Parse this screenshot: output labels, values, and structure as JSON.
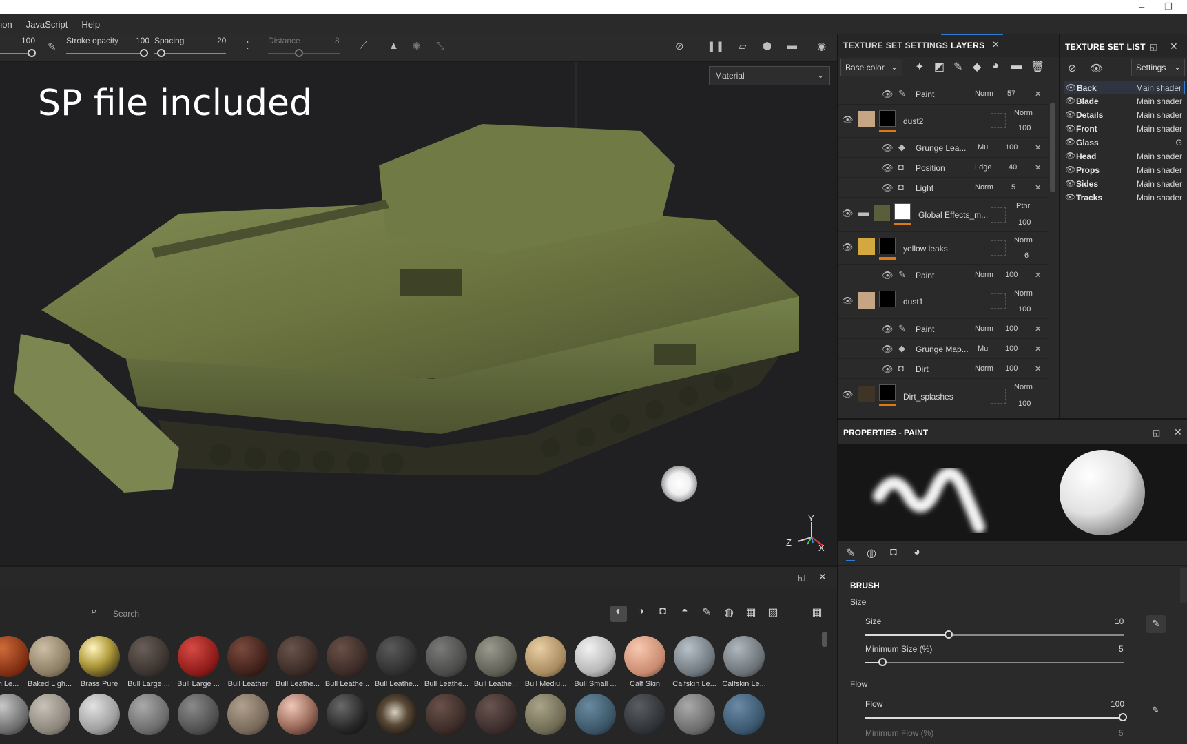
{
  "menubar": {
    "items": [
      "non",
      "JavaScript",
      "Help"
    ]
  },
  "toolbar": {
    "size_value": "100",
    "stroke_opacity_label": "Stroke opacity",
    "stroke_opacity_value": "100",
    "spacing_label": "Spacing",
    "spacing_value": "20",
    "distance_label": "Distance",
    "distance_value": "8"
  },
  "viewport": {
    "overlay_title": "SP file included",
    "material_mode": "Material",
    "axis_labels": {
      "y": "Y",
      "z": "Z",
      "x": "X"
    }
  },
  "layers_panel": {
    "tab_settings": "TEXTURE SET SETTINGS",
    "tab_layers": "LAYERS",
    "channel": "Base color",
    "rows": [
      {
        "kind": "effect",
        "name": "Paint",
        "blend": "Norm",
        "opacity": "57"
      },
      {
        "kind": "layer",
        "name": "dust2",
        "blend": "Norm",
        "opacity": "100"
      },
      {
        "kind": "effect",
        "name": "Grunge Lea...",
        "blend": "Mul",
        "opacity": "100"
      },
      {
        "kind": "effect",
        "name": "Position",
        "blend": "Ldge",
        "opacity": "40"
      },
      {
        "kind": "effect",
        "name": "Light",
        "blend": "Norm",
        "opacity": "5"
      },
      {
        "kind": "folder",
        "name": "Global Effects_m...",
        "blend": "Pthr",
        "opacity": "100"
      },
      {
        "kind": "layer",
        "name": "yellow leaks",
        "blend": "Norm",
        "opacity": "6"
      },
      {
        "kind": "effect",
        "name": "Paint",
        "blend": "Norm",
        "opacity": "100"
      },
      {
        "kind": "layer",
        "name": "dust1",
        "blend": "Norm",
        "opacity": "100"
      },
      {
        "kind": "effect",
        "name": "Paint",
        "blend": "Norm",
        "opacity": "100"
      },
      {
        "kind": "effect",
        "name": "Grunge Map...",
        "blend": "Mul",
        "opacity": "100"
      },
      {
        "kind": "effect",
        "name": "Dirt",
        "blend": "Norm",
        "opacity": "100"
      },
      {
        "kind": "layer",
        "name": "Dirt_splashes",
        "blend": "Norm",
        "opacity": "100"
      }
    ]
  },
  "texture_set_list": {
    "title": "TEXTURE SET LIST",
    "settings_label": "Settings",
    "items": [
      {
        "name": "Back",
        "shader": "Main shader"
      },
      {
        "name": "Blade",
        "shader": "Main shader"
      },
      {
        "name": "Details",
        "shader": "Main shader"
      },
      {
        "name": "Front",
        "shader": "Main shader"
      },
      {
        "name": "Glass",
        "shader": "G"
      },
      {
        "name": "Head",
        "shader": "Main shader"
      },
      {
        "name": "Props",
        "shader": "Main shader"
      },
      {
        "name": "Sides",
        "shader": "Main shader"
      },
      {
        "name": "Tracks",
        "shader": "Main shader"
      }
    ]
  },
  "properties": {
    "title": "PROPERTIES - PAINT",
    "section": "BRUSH",
    "size_group": "Size",
    "size_label": "Size",
    "size_value": "10",
    "min_size_label": "Minimum Size (%)",
    "min_size_value": "5",
    "flow_group": "Flow",
    "flow_label": "Flow",
    "flow_value": "100",
    "min_flow_label": "Minimum Flow (%)",
    "min_flow_value": "5"
  },
  "shelf": {
    "search_placeholder": "Search",
    "row1": [
      "n Le...",
      "Baked Ligh...",
      "Brass Pure",
      "Bull Large ...",
      "Bull Large ...",
      "Bull Leather",
      "Bull Leathe...",
      "Bull Leathe...",
      "Bull Leathe...",
      "Bull Leathe...",
      "Bull Leathe...",
      "Bull Mediu...",
      "Bull Small ...",
      "Calf Skin",
      "Calfskin Le...",
      "Calfskin Le..."
    ]
  }
}
